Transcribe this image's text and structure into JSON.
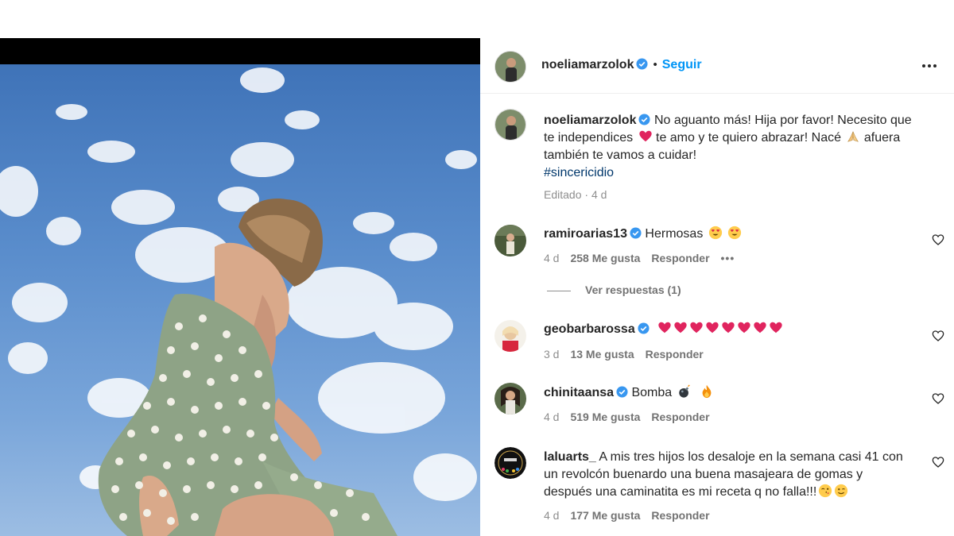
{
  "post": {
    "author": "noeliamarzolok",
    "follow_label": "Seguir",
    "separator": "•",
    "caption_lines": [
      "No aguanto más! Hija por favor! Necesito que",
      "te independices",
      " te amo y te quiero abrazar! Nacé",
      " afuera",
      "también te vamos a cuidar!"
    ],
    "hashtag": "#sincericidio",
    "edited_label": "Editado",
    "edited_dot": "·",
    "time": "4 d"
  },
  "comments": [
    {
      "user": "ramiroarias13",
      "text": "Hermosas",
      "emojis": [
        "heart-eyes",
        "heart-eyes"
      ],
      "time": "4 d",
      "likes": "258 Me gusta",
      "reply": "Responder",
      "more": "•••",
      "view_replies": "Ver respuestas (1)"
    },
    {
      "user": "geobarbarossa",
      "text": "",
      "emojis": [
        "heart",
        "heart",
        "heart",
        "heart",
        "heart",
        "heart",
        "heart",
        "heart"
      ],
      "time": "3 d",
      "likes": "13 Me gusta",
      "reply": "Responder"
    },
    {
      "user": "chinitaansa",
      "text": "Bomba",
      "emojis": [
        "bomb",
        "fire"
      ],
      "time": "4 d",
      "likes": "519 Me gusta",
      "reply": "Responder"
    },
    {
      "user": "laluarts_",
      "lines": [
        "A mis tres hijos los desaloje en la semana casi 41 con",
        "un revolcón buenardo una buena masajeara de gomas y",
        "después una caminatita es mi receta q no falla!!!"
      ],
      "emojis": [
        "wink-kiss",
        "wink"
      ],
      "time": "4 d",
      "likes": "177 Me gusta",
      "reply": "Responder"
    }
  ],
  "colors": {
    "accent": "#0095f6",
    "verified": "#3897f0",
    "heart": "#e0245e",
    "hashtag": "#00376b"
  }
}
